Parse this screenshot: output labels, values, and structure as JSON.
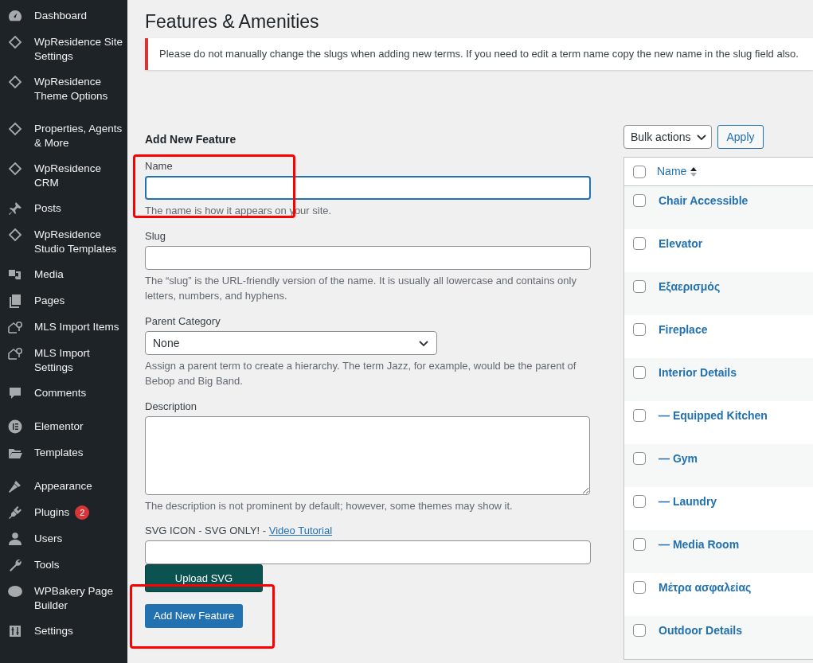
{
  "sidebar": {
    "items": [
      {
        "label": "Dashboard"
      },
      {
        "label": "WpResidence Site Settings"
      },
      {
        "label": "WpResidence Theme Options"
      },
      {
        "label": "Properties, Agents & More"
      },
      {
        "label": "WpResidence CRM"
      },
      {
        "label": "Posts"
      },
      {
        "label": "WpResidence Studio Templates"
      },
      {
        "label": "Media"
      },
      {
        "label": "Pages"
      },
      {
        "label": "MLS Import Items"
      },
      {
        "label": "MLS Import Settings"
      },
      {
        "label": "Comments"
      },
      {
        "label": "Elementor"
      },
      {
        "label": "Templates"
      },
      {
        "label": "Appearance"
      },
      {
        "label": "Plugins",
        "badge": "2"
      },
      {
        "label": "Users"
      },
      {
        "label": "Tools"
      },
      {
        "label": "WPBakery Page Builder"
      },
      {
        "label": "Settings"
      }
    ]
  },
  "page": {
    "title": "Features & Amenities",
    "notice": "Please do not manually change the slugs when adding new terms. If you need to edit a term name copy the new name in the slug field also."
  },
  "form": {
    "heading": "Add New Feature",
    "name": {
      "label": "Name",
      "hint": "The name is how it appears on your site.",
      "focused": true
    },
    "slug": {
      "label": "Slug",
      "hint": "The “slug” is the URL-friendly version of the name. It is usually all lowercase and contains only letters, numbers, and hyphens."
    },
    "parent": {
      "label": "Parent Category",
      "value": "None",
      "hint": "Assign a parent term to create a hierarchy. The term Jazz, for example, would be the parent of Bebop and Big Band."
    },
    "description": {
      "label": "Description",
      "hint": "The description is not prominent by default; however, some themes may show it."
    },
    "svg_icon": {
      "label": "SVG ICON - SVG ONLY! - ",
      "link": "Video Tutorial",
      "upload_button": "Upload SVG"
    },
    "submit": "Add New Feature"
  },
  "list": {
    "bulk_actions": "Bulk actions",
    "apply": "Apply",
    "column_name": "Name",
    "select_all_checked": false,
    "rows": [
      {
        "name": "Chair Accessible",
        "checked": false
      },
      {
        "name": "Elevator",
        "checked": false
      },
      {
        "name": "Εξαερισμός",
        "checked": false
      },
      {
        "name": "Fireplace",
        "checked": false
      },
      {
        "name": "Interior Details",
        "checked": false
      },
      {
        "name": "— Equipped Kitchen",
        "checked": false
      },
      {
        "name": "— Gym",
        "checked": false
      },
      {
        "name": "— Laundry",
        "checked": false
      },
      {
        "name": "— Media Room",
        "checked": false
      },
      {
        "name": "Μέτρα ασφαλείας",
        "checked": false
      },
      {
        "name": "Outdoor Details",
        "checked": false
      }
    ]
  }
}
